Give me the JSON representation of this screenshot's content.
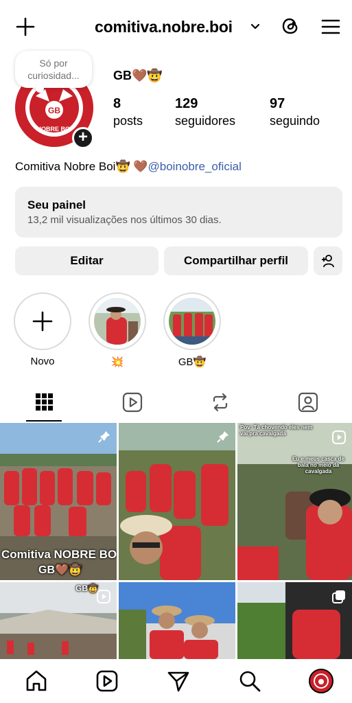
{
  "header": {
    "username": "comitiva.nobre.boi"
  },
  "note": {
    "text": "Só por curiosidad..."
  },
  "profile": {
    "display_name": "GB🤎🤠",
    "logo_text_top": "GB",
    "logo_text_bottom": "NOBRE BOI",
    "stats": [
      {
        "value": "8",
        "label": "posts"
      },
      {
        "value": "129",
        "label": "seguidores"
      },
      {
        "value": "97",
        "label": "seguindo"
      }
    ],
    "bio_text": "Comitiva Nobre Boi🤠 🤎",
    "bio_handle": "@boinobre_oficial"
  },
  "dashboard": {
    "title": "Seu painel",
    "subtitle": "13,2 mil visualizações nos últimos 30 dias."
  },
  "actions": {
    "edit": "Editar",
    "share": "Compartilhar perfil"
  },
  "highlights": [
    {
      "label": "Novo"
    },
    {
      "label": "💥"
    },
    {
      "label": "GB🤠"
    }
  ],
  "tabs": [
    "grid",
    "reels",
    "reposts",
    "tagged"
  ],
  "posts": [
    {
      "overlay": "Comitiva NOBRE BOI",
      "overlay2": "GB🤎🤠"
    },
    {
      "overlay": ""
    },
    {
      "overlay": "Pov: Tá chovendo eles nem vai pra cavalgada",
      "overlay2": "Eu e meus casca de bala no meio da cavalgada"
    },
    {
      "overlay": "GB🤠"
    },
    {
      "overlay": ""
    },
    {
      "overlay": ""
    }
  ],
  "colors": {
    "brand_red": "#c9202a",
    "link": "#3b5ea8",
    "button_bg": "#efefef"
  }
}
